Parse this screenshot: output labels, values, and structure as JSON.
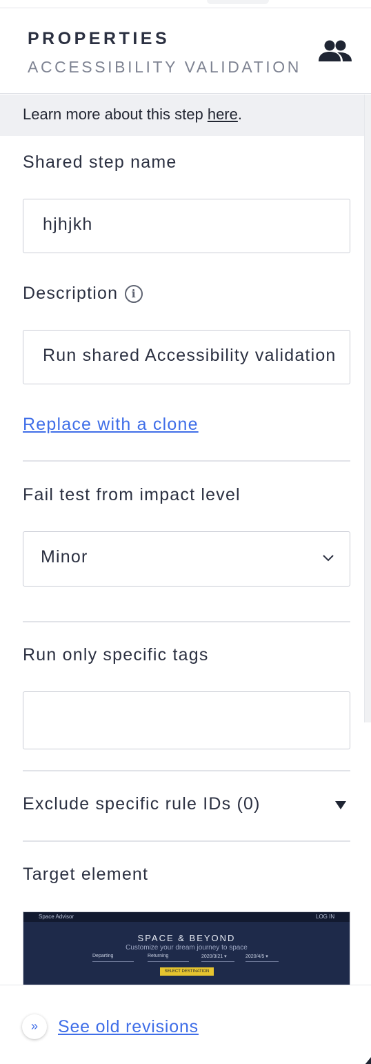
{
  "header": {
    "title": "PROPERTIES",
    "subtitle": "ACCESSIBILITY VALIDATION",
    "shared_icon": "users-icon"
  },
  "info_bar": {
    "text": "Learn more about this step ",
    "link": "here",
    "suffix": "."
  },
  "shared_step_name": {
    "label": "Shared step name",
    "value": "hjhjkh"
  },
  "description": {
    "label": "Description",
    "info_icon": "info-icon",
    "value": "Run shared Accessibility validation"
  },
  "replace_link": "Replace with a clone",
  "impact_level": {
    "label": "Fail test from impact level",
    "selected": "Minor",
    "chevron_icon": "chevron-down-icon"
  },
  "tags": {
    "label": "Run only specific tags",
    "value": ""
  },
  "exclude_rules": {
    "label": "Exclude specific rule IDs (0)",
    "toggle_icon": "triangle-down-icon"
  },
  "target_element": {
    "label": "Target element",
    "preview": {
      "app_name": "Space Advisor",
      "login": "LOG IN",
      "heading": "SPACE & BEYOND",
      "subheading": "Customize your dream journey to space",
      "departing": "Departing",
      "returning": "Returning",
      "date1": "2020/3/21 ▾",
      "date2": "2020/4/5 ▾",
      "button": "SELECT DESTINATION"
    }
  },
  "footer": {
    "expand_icon": "double-chevron-right-icon",
    "link": "See old revisions"
  },
  "colors": {
    "link": "#3f6ee8",
    "text": "#2b3041",
    "border": "#c9ccd5",
    "info_bg": "#eff0f3"
  }
}
